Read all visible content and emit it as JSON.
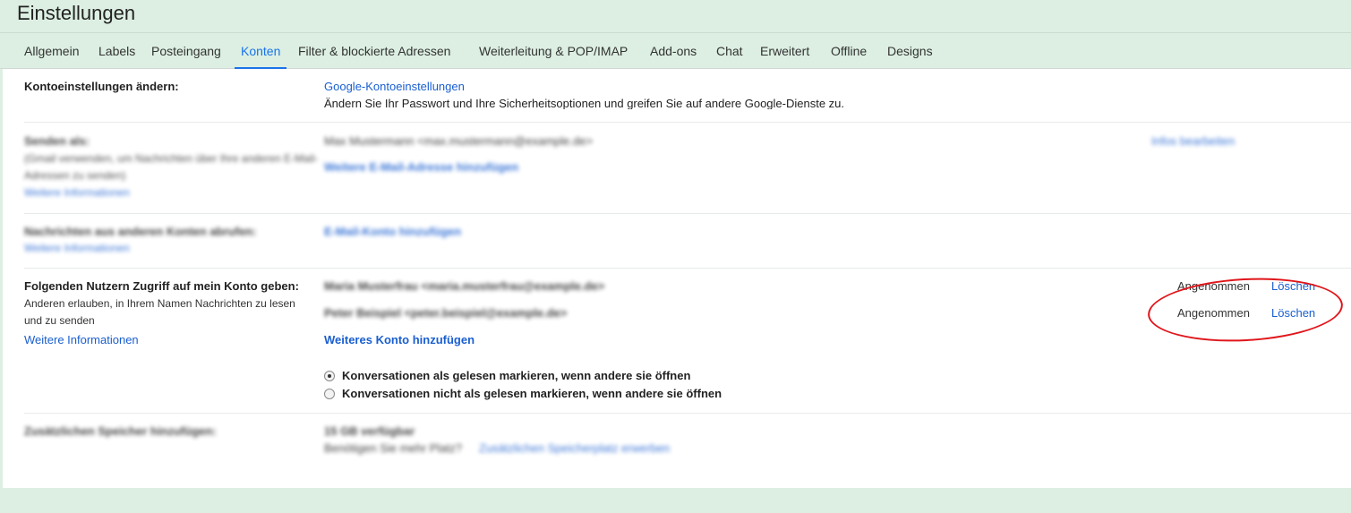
{
  "page": {
    "title": "Einstellungen"
  },
  "tabs": [
    {
      "label": "Allgemein"
    },
    {
      "label": "Labels"
    },
    {
      "label": "Posteingang"
    },
    {
      "label": "Konten"
    },
    {
      "label": "Filter & blockierte Adressen"
    },
    {
      "label": "Weiterleitung & POP/IMAP"
    },
    {
      "label": "Add-ons"
    },
    {
      "label": "Chat"
    },
    {
      "label": "Erweitert"
    },
    {
      "label": "Offline"
    },
    {
      "label": "Designs"
    }
  ],
  "active_tab": "Konten",
  "section_account": {
    "label": "Kontoeinstellungen ändern:",
    "link": "Google-Kontoeinstellungen",
    "description": "Ändern Sie Ihr Passwort und Ihre Sicherheitsoptionen und greifen Sie auf andere Google-Dienste zu."
  },
  "section_send_as": {
    "label": "Senden als:",
    "desc_line1": "(Gmail verwenden, um Nachrichten über Ihre anderen E-Mail-",
    "desc_line2": "Adressen zu senden)",
    "more_info": "Weitere Informationen",
    "address": "Max Mustermann <max.mustermann@example.de>",
    "add_link": "Weitere E-Mail-Adresse hinzufügen",
    "edit_link": "Infos bearbeiten"
  },
  "section_check_mail": {
    "label": "Nachrichten aus anderen Konten abrufen:",
    "more_info": "Weitere Informationen",
    "add_link": "E-Mail-Konto hinzufügen"
  },
  "section_delegation": {
    "label": "Folgenden Nutzern Zugriff auf mein Konto geben:",
    "desc_line1": "Anderen erlauben, in Ihrem Namen Nachrichten zu lesen",
    "desc_line2": "und zu senden",
    "more_info": "Weitere Informationen",
    "delegates": [
      {
        "name": "Maria Musterfrau <maria.musterfrau@example.de>",
        "status": "Angenommen",
        "delete": "Löschen"
      },
      {
        "name": "Peter Beispiel <peter.beispiel@example.de>",
        "status": "Angenommen",
        "delete": "Löschen"
      }
    ],
    "add_account": "Weiteres Konto hinzufügen",
    "options": [
      {
        "label": "Konversationen als gelesen markieren, wenn andere sie öffnen",
        "checked": true
      },
      {
        "label": "Konversationen nicht als gelesen markieren, wenn andere sie öffnen",
        "checked": false
      }
    ]
  },
  "section_storage": {
    "label": "Zusätzlichen Speicher hinzufügen:",
    "usage": "15 GB verfügbar",
    "question": "Benötigen Sie mehr Platz?",
    "upgrade_link": "Zusätzlichen Speicherplatz erwerben"
  },
  "colors": {
    "accent": "#1a73e8",
    "link": "#1a5fd0",
    "background": "#dcefe2",
    "annotation": "#e0161b"
  }
}
